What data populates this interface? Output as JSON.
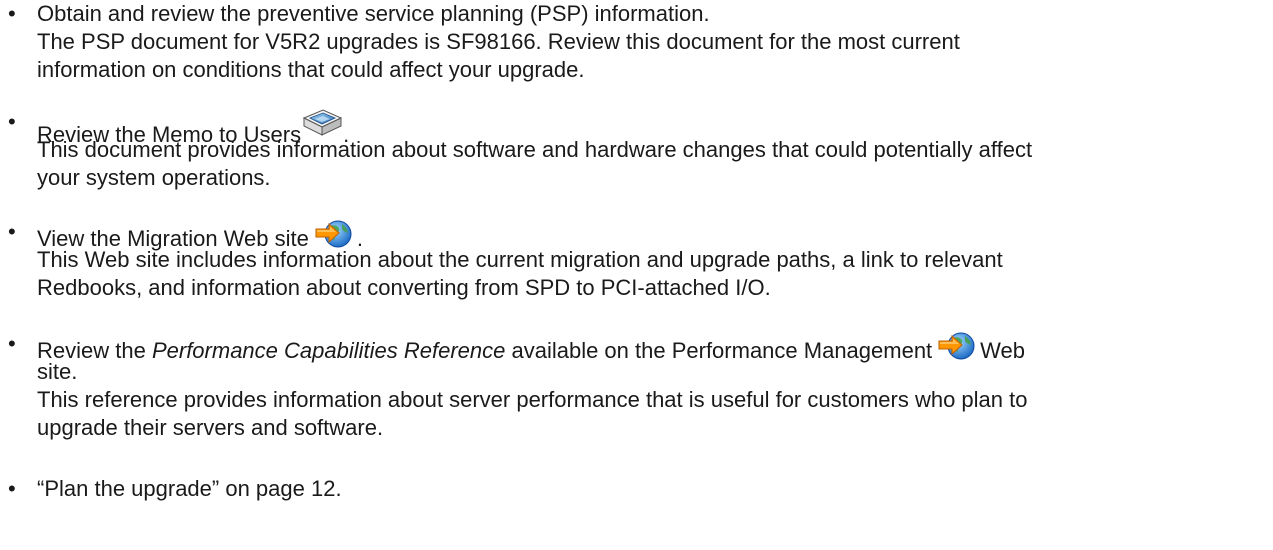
{
  "items": [
    {
      "title": "Obtain and review the preventive service planning (PSP) information.",
      "desc": [
        "The PSP document for V5R2 upgrades is SF98166. Review this document for the most current",
        "information on conditions that could affect your upgrade."
      ]
    },
    {
      "title": "Review the Memo to Users",
      "title_end": ".",
      "icon": "book-icon",
      "desc": [
        "This document provides information about software and hardware changes that could potentially affect",
        "your system operations."
      ]
    },
    {
      "title": "View the Migration Web site",
      "title_end": ".",
      "icon": "globe-arrow-icon",
      "desc": [
        "This Web site includes information about the current migration and upgrade paths, a link to relevant",
        "Redbooks, and information about converting from SPD to PCI-attached I/O."
      ]
    },
    {
      "title_pre": "Review the ",
      "title_italic": "Performance Capabilities Reference",
      "title_mid": " available on the Performance Management",
      "title_end": "Web",
      "title_line2": "site.",
      "icon": "globe-arrow-icon",
      "desc": [
        "This reference provides information about server performance that is useful for customers who plan to",
        "upgrade their servers and software."
      ]
    },
    {
      "title": "“Plan the upgrade” on page 12."
    }
  ],
  "bullet": "•"
}
